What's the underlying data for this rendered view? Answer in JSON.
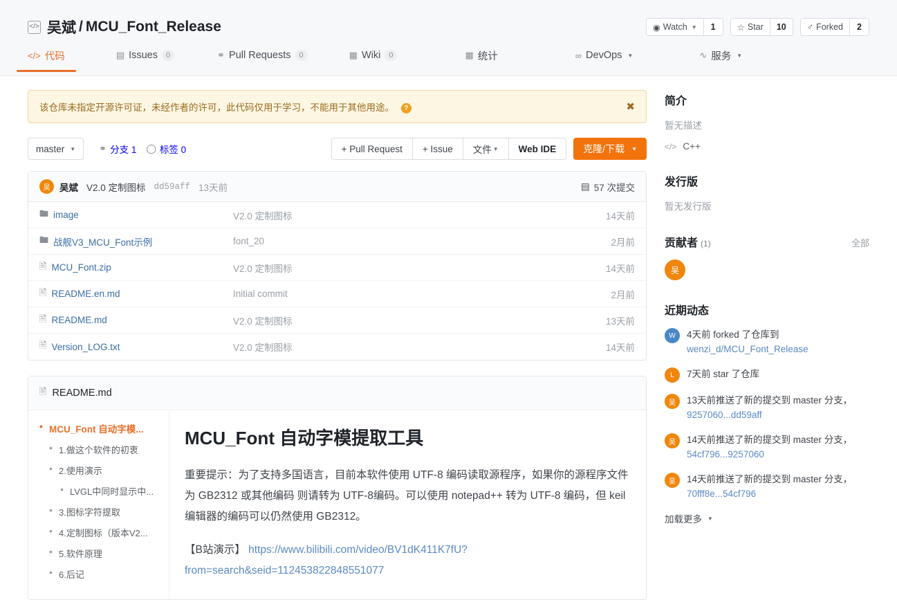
{
  "header": {
    "repo_icon": "code-repo-icon",
    "owner": "吴斌",
    "separator": "/",
    "name": "MCU_Font_Release",
    "actions": [
      {
        "icon": "eye-icon",
        "glyph": "◉",
        "label": "Watch",
        "has_caret": true,
        "count": "1",
        "name": "watch"
      },
      {
        "icon": "star-icon",
        "glyph": "☆",
        "label": "Star",
        "has_caret": false,
        "count": "10",
        "name": "star"
      },
      {
        "icon": "fork-icon",
        "glyph": "⑂",
        "label": "Forked",
        "has_caret": false,
        "count": "2",
        "name": "forked"
      }
    ]
  },
  "tabs": [
    {
      "label": "代码",
      "icon": "code-icon",
      "glyph": "‹›",
      "badge": null,
      "active": true,
      "name": "code"
    },
    {
      "label": "Issues",
      "icon": "issue-icon",
      "glyph": "▤",
      "badge": "0",
      "active": false,
      "name": "issues"
    },
    {
      "label": "Pull Requests",
      "icon": "pull-request-icon",
      "glyph": "⑂",
      "badge": "0",
      "active": false,
      "name": "pull-requests"
    },
    {
      "label": "Wiki",
      "icon": "wiki-icon",
      "glyph": "▦",
      "badge": "0",
      "active": false,
      "name": "wiki"
    },
    {
      "label": "统计",
      "icon": "chart-icon",
      "glyph": "☰",
      "badge": null,
      "active": false,
      "name": "stats"
    },
    {
      "label": "DevOps",
      "icon": "infinity-icon",
      "glyph": "∞",
      "badge": null,
      "active": false,
      "caret": true,
      "name": "devops"
    },
    {
      "label": "服务",
      "icon": "pulse-icon",
      "glyph": "⌇",
      "badge": null,
      "active": false,
      "caret": true,
      "name": "services"
    }
  ],
  "alert": {
    "text": "该仓库未指定开源许可证，未经作者的许可，此代码仅用于学习，不能用于其他用途。",
    "help_glyph": "?",
    "close_glyph": "✖"
  },
  "toolbar": {
    "branch": "master",
    "branches_label": "分支 1",
    "tags_label": "标签 0",
    "pull_request_label": "+ Pull Request",
    "issue_label": "+ Issue",
    "files_label": "文件",
    "webide_label": "Web IDE",
    "clone_label": "克隆/下载"
  },
  "commit_bar": {
    "avatar_text": "吴",
    "author": "吴斌",
    "message": "V2.0 定制图标",
    "sha": "dd59aff",
    "time": "13天前",
    "commits_count": "57 次提交"
  },
  "files": [
    {
      "type": "dir",
      "name": "image",
      "message": "V2.0 定制图标",
      "time": "14天前"
    },
    {
      "type": "dir",
      "name": "战舰V3_MCU_Font示例",
      "message": "font_20",
      "time": "2月前"
    },
    {
      "type": "file",
      "name": "MCU_Font.zip",
      "message": "V2.0 定制图标",
      "time": "14天前"
    },
    {
      "type": "file",
      "name": "README.en.md",
      "message": "Initial commit",
      "time": "2月前"
    },
    {
      "type": "file",
      "name": "README.md",
      "message": "V2.0 定制图标",
      "time": "13天前"
    },
    {
      "type": "file",
      "name": "Version_LOG.txt",
      "message": "V2.0 定制图标",
      "time": "14天前"
    }
  ],
  "readme": {
    "filename": "README.md",
    "toc": [
      {
        "level": 1,
        "label": "MCU_Font 自动字模..."
      },
      {
        "level": 2,
        "label": "1.做这个软件的初衷"
      },
      {
        "level": 2,
        "label": "2.使用演示"
      },
      {
        "level": 3,
        "label": "LVGL中同时显示中..."
      },
      {
        "level": 2,
        "label": "3.图标字符提取"
      },
      {
        "level": 2,
        "label": "4.定制图标（版本V2..."
      },
      {
        "level": 2,
        "label": "5.软件原理"
      },
      {
        "level": 2,
        "label": "6.后记"
      }
    ],
    "title": "MCU_Font 自动字模提取工具",
    "paragraph": "重要提示：为了支持多国语言，目前本软件使用 UTF-8 编码读取源程序，如果你的源程序文件为 GB2312 或其他编码 则请转为 UTF-8编码。可以使用 notepad++ 转为 UTF-8 编码，但 keil 编辑器的编码可以仍然使用 GB2312。",
    "bilibili_prefix": "【B站演示】",
    "bilibili_link": "https://www.bilibili.com/video/BV1dK411K7fU?from=search&seid=112453822848551077"
  },
  "sidebar": {
    "intro_title": "简介",
    "intro_desc": "暂无描述",
    "language": "C++",
    "release_title": "发行版",
    "release_desc": "暂无发行版",
    "contrib_title": "贡献者",
    "contrib_count": "(1)",
    "contrib_all": "全部",
    "contrib_avatar": "吴",
    "activity_title": "近期动态",
    "activity": [
      {
        "avatar": "W",
        "color": "#4a87c8",
        "time": "4天前",
        "text": " forked 了仓库到 ",
        "link": "wenzi_d/MCU_Font_Release"
      },
      {
        "avatar": "L",
        "color": "#f0860c",
        "time": "7天前",
        "text": " star 了仓库",
        "link": ""
      },
      {
        "avatar": "吴",
        "color": "#f0860c",
        "time": "13天前",
        "text": "推送了新的提交到 master 分支，",
        "link": "9257060...dd59aff"
      },
      {
        "avatar": "吴",
        "color": "#f0860c",
        "time": "14天前",
        "text": "推送了新的提交到 master 分支，",
        "link": "54cf796...9257060"
      },
      {
        "avatar": "吴",
        "color": "#f0860c",
        "time": "14天前",
        "text": "推送了新的提交到 master 分支，",
        "link": "70fff8e...54cf796"
      }
    ],
    "load_more": "加载更多"
  }
}
